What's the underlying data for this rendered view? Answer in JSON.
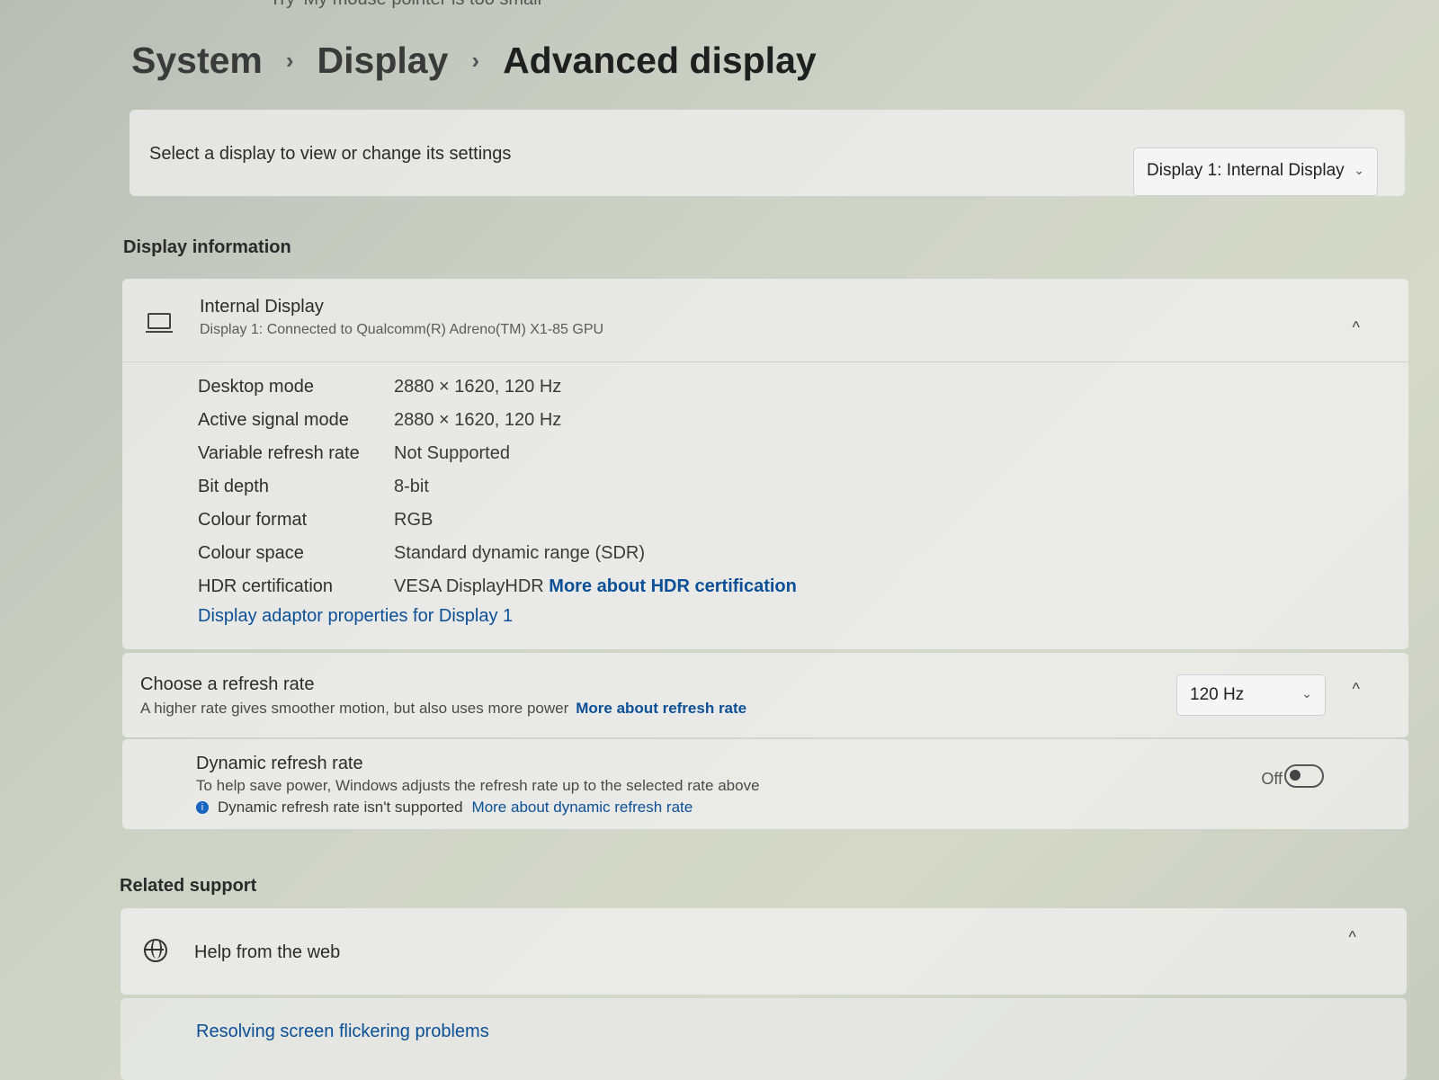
{
  "top_clip": "Try 'My mouse pointer is too small'",
  "breadcrumb": [
    "System",
    "Display",
    "Advanced display"
  ],
  "select_display": {
    "label": "Select a display to view or change its settings",
    "value": "Display 1: Internal Display"
  },
  "display_information": {
    "section_title": "Display information",
    "name": "Internal Display",
    "subtitle": "Display 1: Connected to Qualcomm(R) Adreno(TM) X1-85 GPU",
    "rows": [
      {
        "label": "Desktop mode",
        "value": "2880 × 1620, 120 Hz"
      },
      {
        "label": "Active signal mode",
        "value": "2880 × 1620, 120 Hz"
      },
      {
        "label": "Variable refresh rate",
        "value": "Not Supported"
      },
      {
        "label": "Bit depth",
        "value": "8-bit"
      },
      {
        "label": "Colour format",
        "value": "RGB"
      },
      {
        "label": "Colour space",
        "value": "Standard dynamic range (SDR)"
      },
      {
        "label": "HDR certification",
        "value": "VESA DisplayHDR",
        "link": "More about HDR certification"
      }
    ],
    "adapter_link": "Display adaptor properties for Display 1"
  },
  "refresh": {
    "title": "Choose a refresh rate",
    "subtitle": "A higher rate gives smoother motion, but also uses more power",
    "link": "More about refresh rate",
    "value": "120 Hz"
  },
  "dynamic_refresh": {
    "title": "Dynamic refresh rate",
    "subtitle": "To help save power, Windows adjusts the refresh rate up to the selected rate above",
    "note": "Dynamic refresh rate isn't supported",
    "link": "More about dynamic refresh rate",
    "toggle_state": "Off"
  },
  "related_support": {
    "section_title": "Related support",
    "help": "Help from the web",
    "resolve_link": "Resolving screen flickering problems"
  },
  "icons": {
    "monitor": "monitor-icon",
    "globe": "globe-icon",
    "info": "info-icon",
    "chevron": "chevron-down-icon",
    "collapse": "chevron-up-icon"
  },
  "colors": {
    "link": "#0b4f96",
    "info": "#1565c0"
  }
}
